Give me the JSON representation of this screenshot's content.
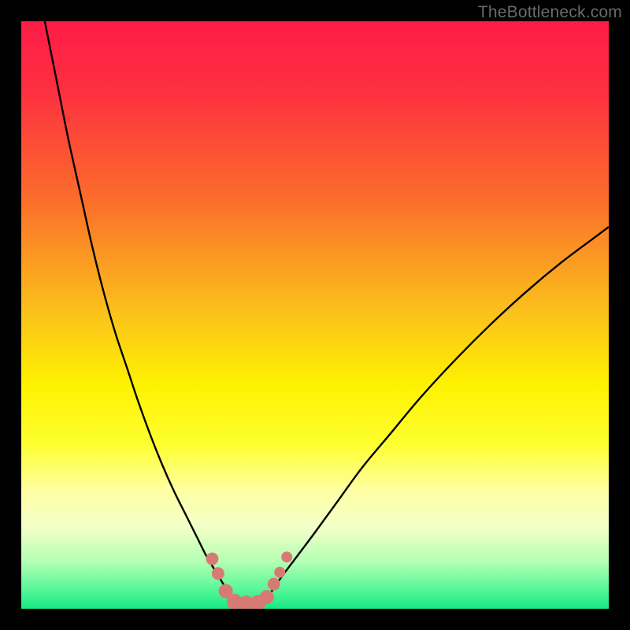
{
  "watermark": "TheBottleneck.com",
  "colors": {
    "frame": "#000000",
    "curve": "#000000",
    "marker_fill": "#d87a74",
    "marker_stroke": "#b95f59",
    "gradient_stops": [
      {
        "offset": 0.0,
        "color": "#fd1c47"
      },
      {
        "offset": 0.12,
        "color": "#fd3040"
      },
      {
        "offset": 0.3,
        "color": "#fb6c2b"
      },
      {
        "offset": 0.5,
        "color": "#fbc31b"
      },
      {
        "offset": 0.62,
        "color": "#fef200"
      },
      {
        "offset": 0.72,
        "color": "#feff30"
      },
      {
        "offset": 0.8,
        "color": "#feffa4"
      },
      {
        "offset": 0.86,
        "color": "#f4ffc8"
      },
      {
        "offset": 0.92,
        "color": "#b3ffb3"
      },
      {
        "offset": 0.965,
        "color": "#5cf79a"
      },
      {
        "offset": 1.0,
        "color": "#17e884"
      }
    ]
  },
  "chart_data": {
    "type": "line",
    "title": "",
    "xlabel": "",
    "ylabel": "",
    "xlim": [
      0,
      100
    ],
    "ylim": [
      0,
      100
    ],
    "series": [
      {
        "name": "left-curve",
        "x": [
          4,
          6,
          8,
          10,
          12,
          14,
          16,
          18,
          20,
          22,
          24,
          26,
          28,
          30,
          31.5,
          33,
          34.5,
          35.5
        ],
        "y": [
          100,
          90,
          80,
          71,
          62,
          54,
          47,
          41,
          35,
          29.5,
          24.5,
          20,
          16,
          12,
          9,
          6.5,
          4,
          2
        ]
      },
      {
        "name": "right-curve",
        "x": [
          42,
          44,
          47,
          50,
          54,
          58,
          63,
          68,
          74,
          80,
          86,
          92,
          98,
          100
        ],
        "y": [
          2,
          5,
          9,
          13,
          18.5,
          24,
          30,
          36,
          42.5,
          48.5,
          54,
          59,
          63.5,
          65
        ]
      },
      {
        "name": "valley-floor",
        "x": [
          35.5,
          37,
          39,
          41,
          42
        ],
        "y": [
          2,
          1.2,
          1.0,
          1.2,
          2
        ]
      }
    ],
    "markers": {
      "name": "observed-points",
      "points": [
        {
          "x": 32.5,
          "y": 8.5,
          "r": 8
        },
        {
          "x": 33.5,
          "y": 6.0,
          "r": 8
        },
        {
          "x": 34.8,
          "y": 3.0,
          "r": 9
        },
        {
          "x": 36.3,
          "y": 1.2,
          "r": 10
        },
        {
          "x": 38.3,
          "y": 0.9,
          "r": 10
        },
        {
          "x": 40.3,
          "y": 1.0,
          "r": 10
        },
        {
          "x": 41.8,
          "y": 2.0,
          "r": 9
        },
        {
          "x": 43.0,
          "y": 4.2,
          "r": 8
        },
        {
          "x": 44.0,
          "y": 6.2,
          "r": 7
        },
        {
          "x": 45.2,
          "y": 8.8,
          "r": 7
        }
      ]
    }
  }
}
